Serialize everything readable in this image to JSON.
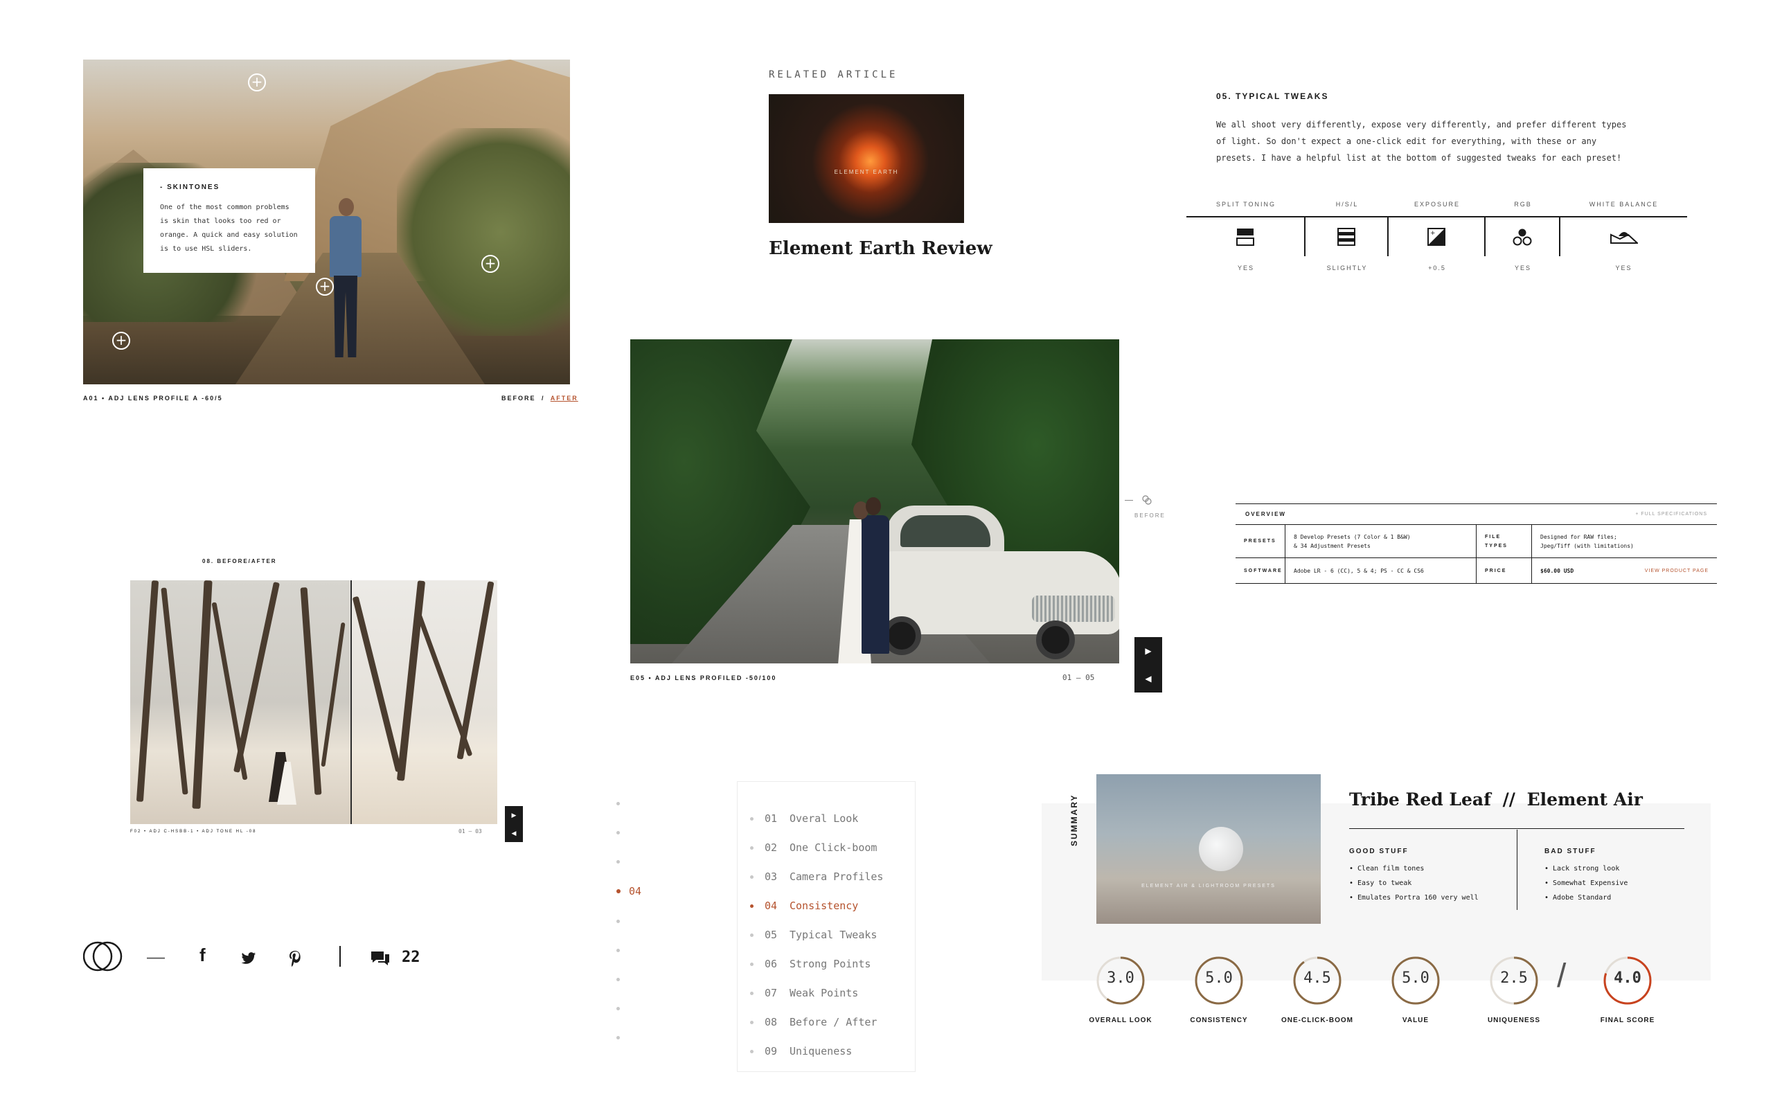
{
  "panel_skintones": {
    "heading": "- SKINTONES",
    "body": "One of the most common problems is skin that looks too red or orange. A quick and easy solution is to use HSL sliders.",
    "caption": "A01 • ADJ LENS PROFILE A -60/5",
    "before": "BEFORE",
    "slash": "/",
    "after": "AFTER"
  },
  "related": {
    "label": "RELATED ARTICLE",
    "title": "Element Earth Review"
  },
  "tweaks": {
    "heading": "05. TYPICAL TWEAKS",
    "body": "We all shoot very differently, expose very differently, and prefer different types of light. So don't expect a one-click edit for everything, with these or any presets. I have a helpful list at the bottom of suggested tweaks for each preset!",
    "columns": [
      {
        "label": "SPLIT TONING",
        "value": "YES",
        "icon": "split-toning-icon"
      },
      {
        "label": "H/S/L",
        "value": "SLIGHTLY",
        "icon": "hsl-icon"
      },
      {
        "label": "EXPOSURE",
        "value": "+0.5",
        "icon": "exposure-icon"
      },
      {
        "label": "RGB",
        "value": "YES",
        "icon": "rgb-icon"
      },
      {
        "label": "WHITE BALANCE",
        "value": "YES",
        "icon": "white-balance-icon"
      }
    ]
  },
  "car_panel": {
    "caption": "E05 • ADJ LENS PROFILED -50/100",
    "counter": "01 — 05",
    "before": "BEFORE"
  },
  "overview": {
    "title": "OVERVIEW",
    "full_specs": "+ FULL SPECIFICATIONS",
    "presets_label": "PRESETS",
    "presets_value_1": "8 Develop Presets (7 Color & 1 B&W)",
    "presets_value_2": "& 34 Adjustment Presets",
    "file_types_label": "FILE TYPES",
    "file_types_value_1": "Designed for RAW files;",
    "file_types_value_2": "Jpeg/Tiff (with limitations)",
    "software_label": "SOFTWARE",
    "software_value": "Adobe LR - 6 (CC), 5 & 4; PS - CC & CS6",
    "price_label": "PRICE",
    "price_value": "$60.00 USD",
    "view_product": "VIEW PRODUCT PAGE"
  },
  "before_after": {
    "heading": "08. BEFORE/AFTER",
    "caption": "F02 • ADJ C-HSBB-1 • ADJ TONE HL -08",
    "counter": "01 — 03"
  },
  "toc": {
    "active_number": "04",
    "items": [
      {
        "num": "01",
        "label": "Overal Look"
      },
      {
        "num": "02",
        "label": "One Click-boom"
      },
      {
        "num": "03",
        "label": "Camera Profiles"
      },
      {
        "num": "04",
        "label": "Consistency"
      },
      {
        "num": "05",
        "label": "Typical Tweaks"
      },
      {
        "num": "06",
        "label": "Strong Points"
      },
      {
        "num": "07",
        "label": "Weak Points"
      },
      {
        "num": "08",
        "label": "Before / After"
      },
      {
        "num": "09",
        "label": "Uniqueness"
      }
    ]
  },
  "share": {
    "dash": "—",
    "facebook": "f",
    "comments": "22"
  },
  "summary": {
    "side_label": "SUMMARY",
    "title_left": "Tribe Red Leaf",
    "title_sep": "//",
    "title_right": "Element Air",
    "image_caption": "ELEMENT AIR & LIGHTROOM PRESETS",
    "good_heading": "GOOD STUFF",
    "good": [
      "• Clean film tones",
      "• Easy to tweak",
      "• Emulates Portra 160 very well"
    ],
    "bad_heading": "BAD STUFF",
    "bad": [
      "• Lack strong look",
      "• Somewhat Expensive",
      "• Adobe Standard"
    ],
    "scores": [
      {
        "value": "3.0",
        "label": "OVERALL LOOK",
        "fraction": 0.6
      },
      {
        "value": "5.0",
        "label": "CONSISTENCY",
        "fraction": 1.0
      },
      {
        "value": "4.5",
        "label": "ONE-CLICK-BOOM",
        "fraction": 0.9
      },
      {
        "value": "5.0",
        "label": "VALUE",
        "fraction": 1.0
      },
      {
        "value": "2.5",
        "label": "UNIQUENESS",
        "fraction": 0.5
      }
    ],
    "final": {
      "value": "4.0",
      "label": "FINAL SCORE",
      "fraction": 0.8
    },
    "score_separator": "/"
  },
  "colors": {
    "accent": "#b5532e",
    "ring": "#8a6a45",
    "ring_track": "#e2ddd6",
    "final_ring": "#c8431f"
  }
}
